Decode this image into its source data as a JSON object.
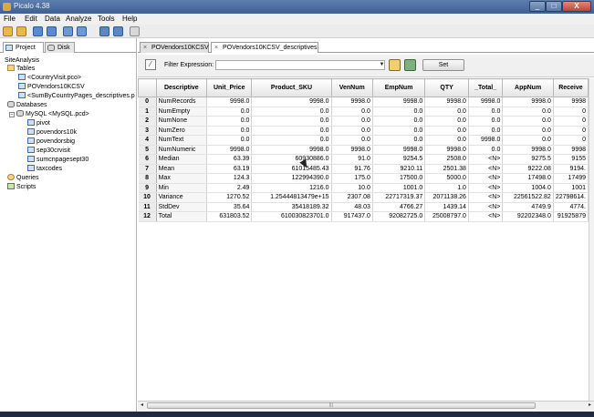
{
  "window": {
    "title": "Picalo 4.38",
    "minimize": "_",
    "maximize": "□",
    "close": "X"
  },
  "menu": [
    "File",
    "Edit",
    "Data",
    "Analyze",
    "Tools",
    "Help"
  ],
  "panel_tabs": [
    "Project",
    "Disk"
  ],
  "tree": {
    "root": "SiteAnalysis",
    "tables_label": "Tables",
    "tables": [
      "<CountryVisit.pco>",
      "POVendors10KCSV",
      "<SumByCountryPages_descriptives.p"
    ],
    "databases_label": "Databases",
    "db_name": "MySQL <MySQL.pcd>",
    "db_tables": [
      "pivot",
      "povendors10k",
      "povendorsbig",
      "sep30crvisit",
      "sumcnpagesept30",
      "taxcodes"
    ],
    "queries_label": "Queries",
    "scripts_label": "Scripts"
  },
  "doc_tabs": [
    {
      "label": "POVendors10KCSV",
      "close": "×"
    },
    {
      "label": "POVendors10KCSV_descriptives",
      "close": "×"
    }
  ],
  "filter": {
    "label": "Filter Expression:",
    "value": "",
    "set_label": "Set"
  },
  "grid": {
    "columns": [
      "Descriptive",
      "Unit_Price",
      "Product_SKU",
      "VenNum",
      "EmpNum",
      "QTY",
      "_Total_",
      "AppNum",
      "Receive"
    ],
    "rows": [
      [
        "0",
        "NumRecords",
        "9998.0",
        "9998.0",
        "9998.0",
        "9998.0",
        "9998.0",
        "9998.0",
        "9998.0",
        "9998"
      ],
      [
        "1",
        "NumEmpty",
        "0.0",
        "0.0",
        "0.0",
        "0.0",
        "0.0",
        "0.0",
        "0.0",
        "0"
      ],
      [
        "2",
        "NumNone",
        "0.0",
        "0.0",
        "0.0",
        "0.0",
        "0.0",
        "0.0",
        "0.0",
        "0"
      ],
      [
        "3",
        "NumZero",
        "0.0",
        "0.0",
        "0.0",
        "0.0",
        "0.0",
        "0.0",
        "0.0",
        "0"
      ],
      [
        "4",
        "NumText",
        "0.0",
        "0.0",
        "0.0",
        "0.0",
        "0.0",
        "9998.0",
        "0.0",
        "0"
      ],
      [
        "5",
        "NumNumeric",
        "9998.0",
        "9998.0",
        "9998.0",
        "9998.0",
        "9998.0",
        "0.0",
        "9998.0",
        "9998"
      ],
      [
        "6",
        "Median",
        "63.39",
        "60930886.0",
        "91.0",
        "9254.5",
        "2508.0",
        "<N>",
        "9275.5",
        "9155"
      ],
      [
        "7",
        "Mean",
        "63.19",
        "61015485.43",
        "91.76",
        "9210.11",
        "2501.38",
        "<N>",
        "9222.08",
        "9194."
      ],
      [
        "8",
        "Max",
        "124.3",
        "122994390.0",
        "175.0",
        "17500.0",
        "5000.0",
        "<N>",
        "17498.0",
        "17499"
      ],
      [
        "9",
        "Min",
        "2.49",
        "1216.0",
        "10.0",
        "1001.0",
        "1.0",
        "<N>",
        "1004.0",
        "1001"
      ],
      [
        "10",
        "Variance",
        "1270.52",
        "1.25444813479e+15",
        "2307.08",
        "22717319.37",
        "2071138.26",
        "<N>",
        "22561522.82",
        "22798614."
      ],
      [
        "11",
        "StdDev",
        "35.64",
        "35418189.32",
        "48.03",
        "4766.27",
        "1439.14",
        "<N>",
        "4749.9",
        "4774."
      ],
      [
        "12",
        "Total",
        "631803.52",
        "610030823701.0",
        "917437.0",
        "92082725.0",
        "25008797.0",
        "<N>",
        "92202348.0",
        "91925879"
      ]
    ]
  },
  "scroll": {
    "left": "◂",
    "right": "▸",
    "grip": "|||"
  },
  "colors": {
    "title_bar": "#4a6ea0",
    "close_button": "#c0452f",
    "selection": "#dde8f6"
  }
}
